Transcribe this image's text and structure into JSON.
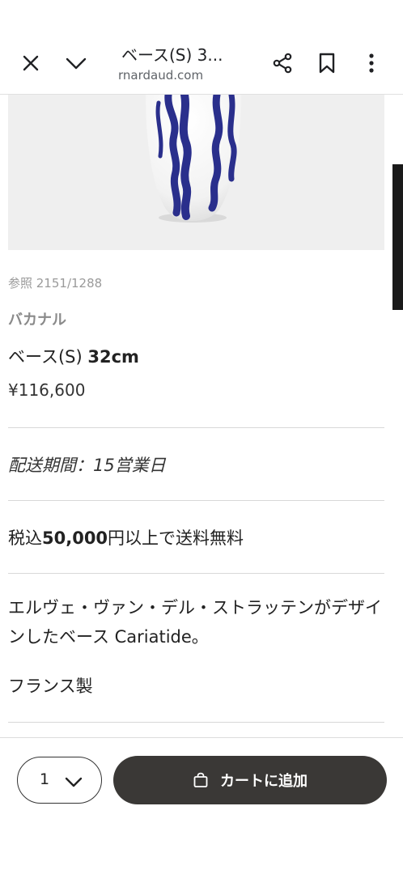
{
  "browser": {
    "title": "ベース(S) 3...",
    "url": "rnardaud.com",
    "icons": [
      "close-icon",
      "chevron-down-icon",
      "share-icon",
      "bookmark-icon",
      "more-vert-icon"
    ]
  },
  "product": {
    "reference": "参照 2151/1288",
    "collection": "バカナル",
    "name_main": "ベース(S) ",
    "name_size": "32cm",
    "price": "¥116,600",
    "delivery": "配送期間：15営業日",
    "shipping_prefix": "税込",
    "shipping_amount": "50,000",
    "shipping_suffix": "円以上で送料無料",
    "description": "エルヴェ・ヴァン・デル・ストラッテンがデザインしたベース Cariatide。",
    "origin": "フランス製"
  },
  "bottom": {
    "quantity": "1",
    "cart_label": "カートに追加"
  },
  "colors": {
    "cart_button": "#3a3836",
    "vase_blue": "#2a2f8c",
    "image_bg": "#efefef"
  }
}
